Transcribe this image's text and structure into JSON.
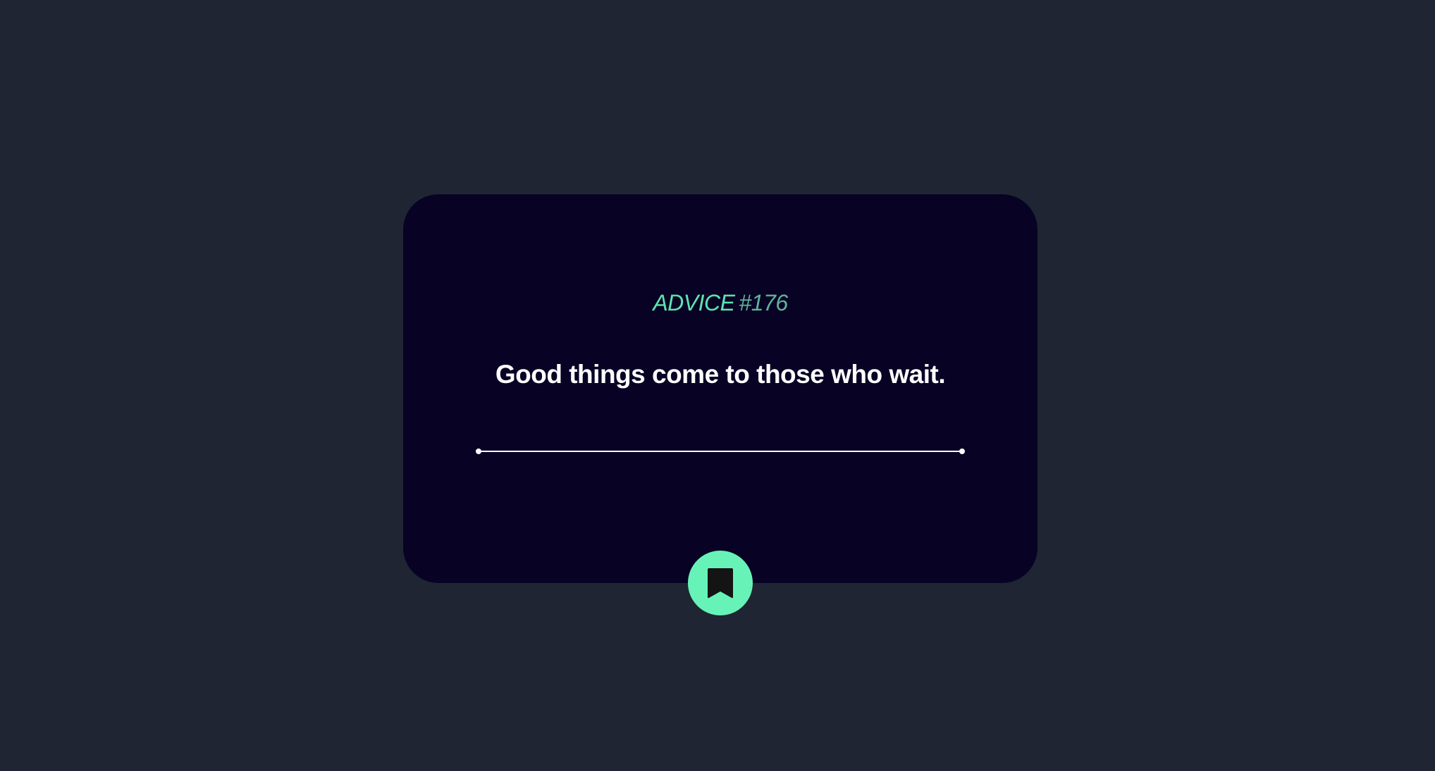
{
  "card": {
    "heading_label": "ADVICE",
    "heading_number": "#176",
    "advice": "Good things come to those who wait."
  },
  "button": {
    "icon": "bookmark-icon",
    "aria_label": "New advice"
  },
  "colors": {
    "page_background": "#1f2532",
    "card_background": "#080325",
    "accent": "#67f3b7",
    "heading": "#5fe3b0",
    "text": "#ffffff"
  }
}
